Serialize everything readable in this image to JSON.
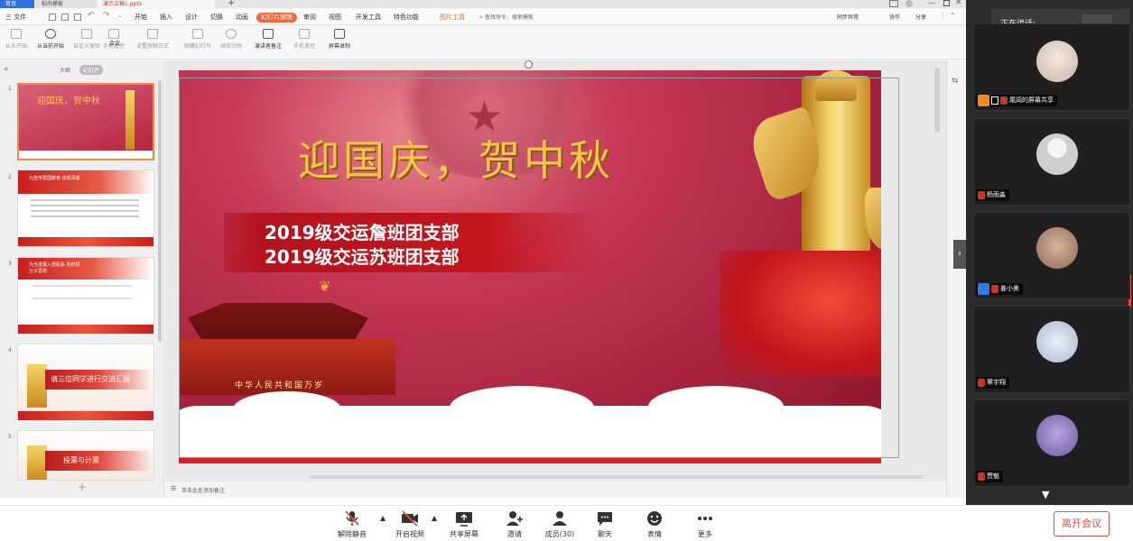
{
  "wps": {
    "tabs": {
      "home": "首页",
      "template": "稻壳模板",
      "doc": "演示文稿1.pptx"
    },
    "menu": {
      "file": "三 文件",
      "items": [
        "开始",
        "插入",
        "设计",
        "切换",
        "动画",
        "幻灯片放映",
        "审阅",
        "视图",
        "开发工具",
        "特色功能"
      ],
      "active": "幻灯片放映",
      "picture_tools": "图片工具",
      "search_placeholder": "查找命令、搜索模板",
      "sync": "同步异常",
      "collab": "协作",
      "share": "分享"
    },
    "ribbon": [
      {
        "label": "从头开始",
        "enabled": false
      },
      {
        "label": "从当前开始",
        "enabled": true
      },
      {
        "label": "自定义放映",
        "enabled": false
      },
      {
        "label": "手机遥控",
        "enabled": false
      },
      {
        "label": "会议",
        "enabled": true
      },
      {
        "label": "设置放映方式",
        "enabled": false
      },
      {
        "label": "隐藏幻灯片",
        "enabled": false
      },
      {
        "label": "排练计时",
        "enabled": false
      },
      {
        "label": "演讲者备注",
        "enabled": true
      },
      {
        "label": "手机遥控",
        "enabled": false
      },
      {
        "label": "屏幕录制",
        "enabled": true
      }
    ],
    "panel": {
      "outline": "大纲",
      "slides": "幻灯片"
    },
    "thumbnails": [
      {
        "num": "1",
        "title": "迎国庆，贺中秋"
      },
      {
        "num": "2",
        "title": "为宣传爱国教育 体现青春"
      },
      {
        "num": "3",
        "title": "为当发展入党联系 的积极分子思想"
      },
      {
        "num": "4",
        "title": "请三位同学进行交流汇报"
      },
      {
        "num": "5",
        "title": "投票与计票"
      }
    ],
    "slide": {
      "title": "迎国庆，贺中秋",
      "line1": "2019级交运詹班团支部",
      "line2": "2019级交运苏班团支部",
      "gate_sign": "中华人民共和国万岁"
    },
    "notes_placeholder": "单击此处添加备注"
  },
  "meeting": {
    "speaking_label": "正在讲话:",
    "participants": [
      {
        "name": "尾闾的屏幕共享",
        "badge": "orange"
      },
      {
        "name": "杨雨淼",
        "badge": ""
      },
      {
        "name": "姜小美",
        "badge": "blue"
      },
      {
        "name": "覃宇翔",
        "badge": ""
      },
      {
        "name": "贾魁",
        "badge": ""
      }
    ]
  },
  "toolbar": {
    "unmute": "解除静音",
    "video": "开启视频",
    "share": "共享屏幕",
    "invite": "邀请",
    "members": "成员(30)",
    "chat": "聊天",
    "reactions": "表情",
    "more": "更多",
    "leave": "离开会议"
  },
  "colors": {
    "accent": "#ec6a3e",
    "leave": "#e0504a",
    "meeting_bg": "#2b2b2b"
  }
}
